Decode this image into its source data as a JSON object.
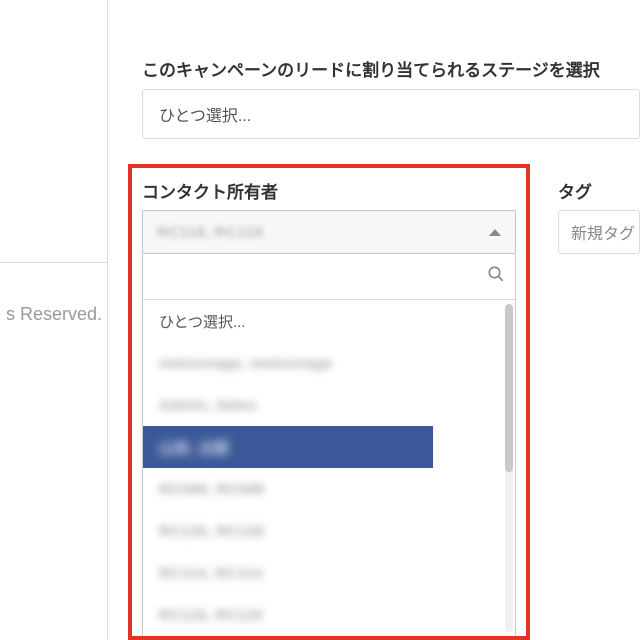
{
  "footer": {
    "text": "s Reserved."
  },
  "top": {
    "label": "このキャンペーンのリードに割り当てられるステージを選択",
    "placeholder": "ひとつ選択..."
  },
  "owner": {
    "label": "コンタクト所有者",
    "selected": "RC118, RC118",
    "search_placeholder": "",
    "options": [
      {
        "label": "ひとつ選択...",
        "blurred": false,
        "highlighted": false,
        "placeholder": true
      },
      {
        "label": "matsunaga, matsunaga",
        "blurred": true,
        "highlighted": false
      },
      {
        "label": "Admin, Sales",
        "blurred": true,
        "highlighted": false
      },
      {
        "label": "山本, 太郎",
        "blurred": true,
        "highlighted": true
      },
      {
        "label": "RC099, RC099",
        "blurred": true,
        "highlighted": false
      },
      {
        "label": "RC126, RC126",
        "blurred": true,
        "highlighted": false
      },
      {
        "label": "RC114, RC114",
        "blurred": true,
        "highlighted": false
      },
      {
        "label": "RC118, RC118",
        "blurred": true,
        "highlighted": false
      }
    ]
  },
  "tags": {
    "label": "タグ",
    "placeholder": "新規タグ"
  }
}
